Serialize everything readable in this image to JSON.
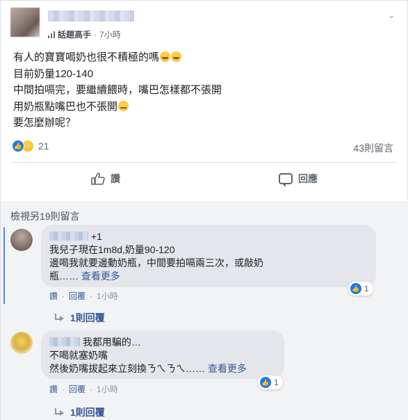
{
  "post": {
    "badge_label": "話題高手",
    "time": "7小時",
    "lines": [
      "有人的寶寶喝奶也很不積極的嗎",
      "目前奶量120-140",
      "中間拍嗝完，要繼續餵時，嘴巴怎樣都不張開",
      "用奶瓶點嘴巴也不張開",
      "要怎麼辦呢？"
    ],
    "reaction_count": "21",
    "comment_count": "43則留言"
  },
  "actions": {
    "like_label": "讚",
    "reply_label": "回應"
  },
  "comments": {
    "view_more": "檢視另19則留言",
    "items": [
      {
        "name_suffix": "+1",
        "lines": [
          "我兒子現在1m8d,奶量90-120",
          "邊喝我就要邊動奶瓶，中間要拍嗝兩三次，或敲奶",
          "瓶……"
        ],
        "see_more": "查看更多",
        "reaction_count": "1",
        "like": "讚",
        "reply": "回覆",
        "time": "1小時",
        "replies": "1則回覆"
      },
      {
        "name_suffix": "我都用騙的…",
        "lines": [
          "不喝就塞奶嘴",
          "然後奶嘴拔起來立刻換ㄋㄟㄋㄟ……"
        ],
        "see_more": "查看更多",
        "reaction_count": "1",
        "like": "讚",
        "reply": "回覆",
        "time": "1小時",
        "replies": "1則回覆"
      }
    ]
  },
  "icons": {
    "menu": "chevron-down-icon",
    "like": "thumbs-up-icon",
    "comment": "speech-bubble-icon",
    "reply": "reply-arrow-icon"
  },
  "colors": {
    "link": "#385898",
    "like_blue": "#1877f2",
    "thread_line": "#4d87f2",
    "bubble": "#e4e6eb"
  }
}
